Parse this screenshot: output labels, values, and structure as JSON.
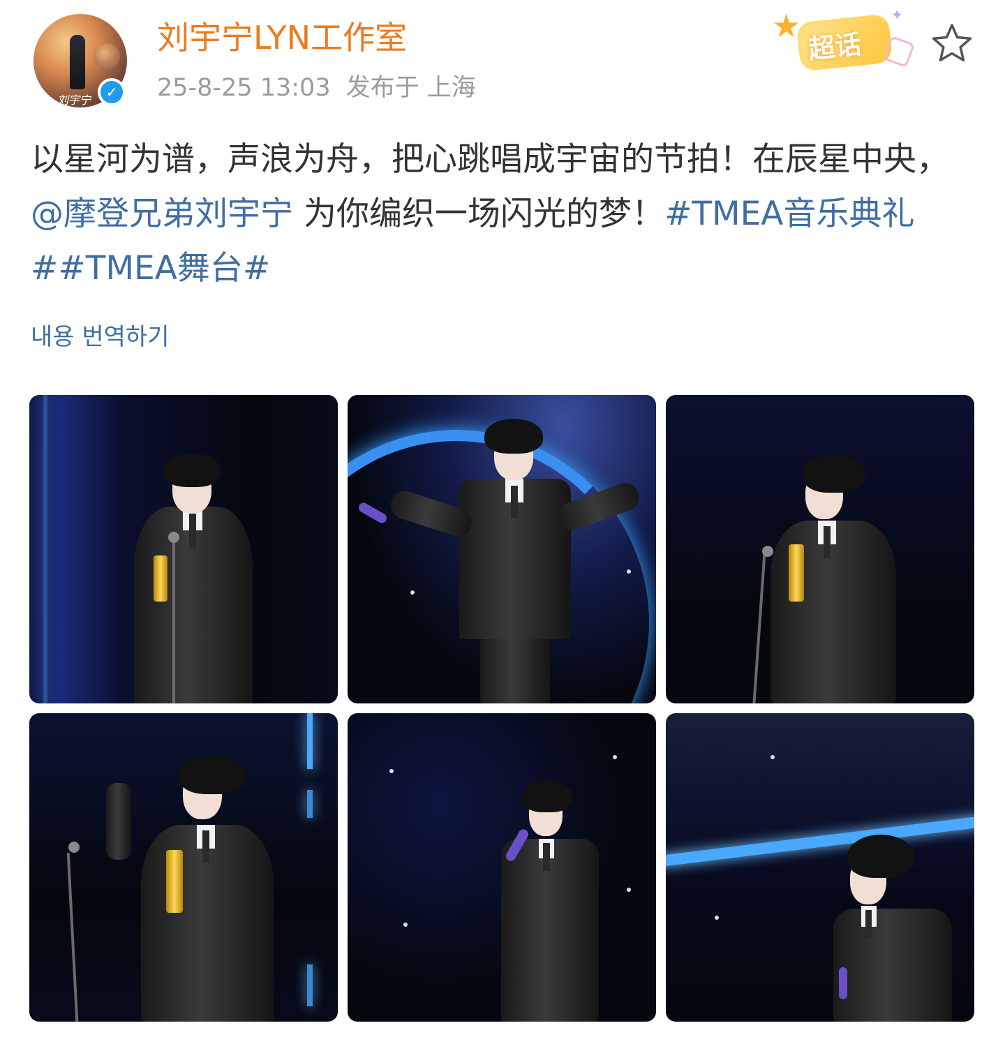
{
  "post": {
    "author": {
      "name": "刘宇宁LYN工作室",
      "avatar_signature": "刘宇宁",
      "verified": true
    },
    "timestamp": "25-8-25 13:03",
    "location": "发布于 上海",
    "supertopic_label": "超话",
    "text_part1": "以星河为谱，声浪为舟，把心跳唱成宇宙的节拍！在辰星中央，",
    "mention": "@摩登兄弟刘宇宁",
    "text_part2": " 为你编织一场闪光的梦！",
    "hashtags": [
      "#TMEA音乐典礼#",
      "#TMEA舞台#"
    ],
    "translate_label": "내용 번역하기"
  },
  "photos": [
    {
      "id": "photo-1"
    },
    {
      "id": "photo-2"
    },
    {
      "id": "photo-3"
    },
    {
      "id": "photo-4"
    },
    {
      "id": "photo-5"
    },
    {
      "id": "photo-6"
    }
  ],
  "colors": {
    "author_name": "#ee7a1b",
    "link": "#3f6ea3",
    "meta": "#9b9b9b",
    "body_text": "#333333",
    "verified": "#1f9bf0",
    "supertopic_badge": "#ffc53d"
  },
  "icons": {
    "verified": "verified-check-icon",
    "favorite": "star-outline-icon",
    "supertopic": "supertopic-badge-icon"
  }
}
